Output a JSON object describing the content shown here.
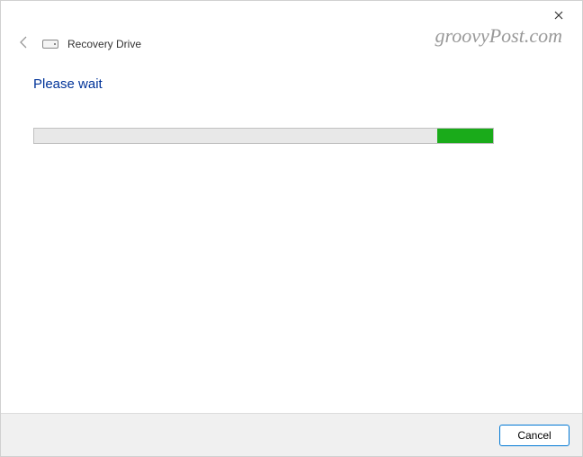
{
  "header": {
    "app_title": "Recovery Drive"
  },
  "content": {
    "status_text": "Please wait"
  },
  "progress": {
    "mode": "indeterminate",
    "segment_left_percent": 87.8,
    "segment_width_percent": 12.2
  },
  "footer": {
    "cancel_label": "Cancel"
  },
  "watermark": {
    "text": "groovyPost.com"
  },
  "icons": {
    "close": "close-icon",
    "back": "back-arrow-icon",
    "drive": "drive-icon"
  }
}
